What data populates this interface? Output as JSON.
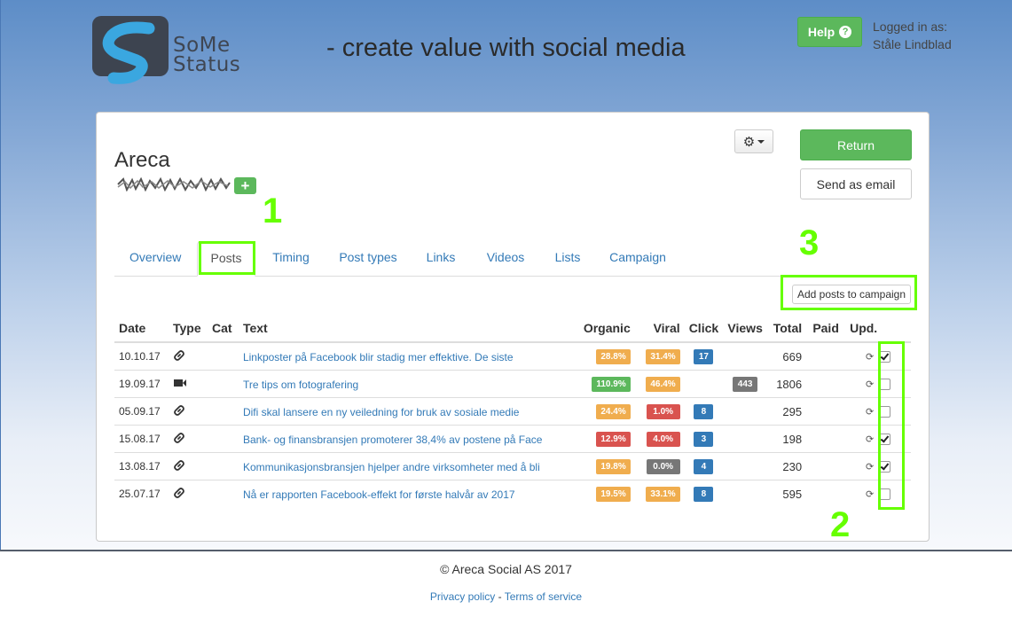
{
  "header": {
    "logo_text_line1": "SoMe",
    "logo_text_line2": "Status",
    "tagline": "- create value with social media",
    "help_label": "Help",
    "logged_in_label": "Logged in as:",
    "user_name": "Ståle Lindblad"
  },
  "client": {
    "name": "Areca",
    "add_label": "+"
  },
  "actions": {
    "return_label": "Return",
    "send_email_label": "Send as email",
    "add_to_campaign_label": "Add posts to campaign"
  },
  "tabs": [
    {
      "label": "Overview",
      "active": false
    },
    {
      "label": "Posts",
      "active": true
    },
    {
      "label": "Timing",
      "active": false
    },
    {
      "label": "Post types",
      "active": false
    },
    {
      "label": "Links",
      "active": false
    },
    {
      "label": "Videos",
      "active": false
    },
    {
      "label": "Lists",
      "active": false
    },
    {
      "label": "Campaign",
      "active": false
    }
  ],
  "table": {
    "headers": [
      "Date",
      "Type",
      "Cat",
      "Text",
      "Organic",
      "Viral",
      "Click",
      "Views",
      "Total",
      "Paid",
      "Upd."
    ],
    "rows": [
      {
        "date": "10.10.17",
        "type": "link",
        "text": "Linkposter på Facebook blir stadig mer effektive. De siste",
        "organic": "28.8%",
        "organic_color": "#f0ad4e",
        "viral": "31.4%",
        "viral_color": "#f0ad4e",
        "click": "17",
        "views": "",
        "total": "669",
        "checked": true
      },
      {
        "date": "19.09.17",
        "type": "video",
        "text": "Tre tips om fotografering",
        "organic": "110.9%",
        "organic_color": "#5cb85c",
        "viral": "46.4%",
        "viral_color": "#f0ad4e",
        "click": "",
        "views": "443",
        "total": "1806",
        "checked": false
      },
      {
        "date": "05.09.17",
        "type": "link",
        "text": "Difi skal lansere en ny veiledning for bruk av sosiale medie",
        "organic": "24.4%",
        "organic_color": "#f0ad4e",
        "viral": "1.0%",
        "viral_color": "#d9534f",
        "click": "8",
        "views": "",
        "total": "295",
        "checked": false
      },
      {
        "date": "15.08.17",
        "type": "link",
        "text": "Bank- og finansbransjen promoterer 38,4% av postene på Face",
        "organic": "12.9%",
        "organic_color": "#d9534f",
        "viral": "4.0%",
        "viral_color": "#d9534f",
        "click": "3",
        "views": "",
        "total": "198",
        "checked": true
      },
      {
        "date": "13.08.17",
        "type": "link",
        "text": "Kommunikasjonsbransjen hjelper andre virksomheter med å bli",
        "organic": "19.8%",
        "organic_color": "#f0ad4e",
        "viral": "0.0%",
        "viral_color": "#777777",
        "click": "4",
        "views": "",
        "total": "230",
        "checked": true
      },
      {
        "date": "25.07.17",
        "type": "link",
        "text": "Nå er rapporten Facebook-effekt for første halvår av 2017",
        "organic": "19.5%",
        "organic_color": "#f0ad4e",
        "viral": "33.1%",
        "viral_color": "#f0ad4e",
        "click": "8",
        "views": "",
        "total": "595",
        "checked": false
      }
    ]
  },
  "annotations": [
    "1",
    "2",
    "3"
  ],
  "footer": {
    "copyright_symbol": "©",
    "copyright": "Areca Social AS 2017",
    "privacy": "Privacy policy",
    "separator": "-",
    "terms": "Terms of service"
  },
  "colors": {
    "accent_green": "#5cb85c",
    "link_blue": "#337ab7",
    "label_blue": "#337ab7",
    "label_gray": "#777777",
    "annotation_green": "#66ff00"
  }
}
